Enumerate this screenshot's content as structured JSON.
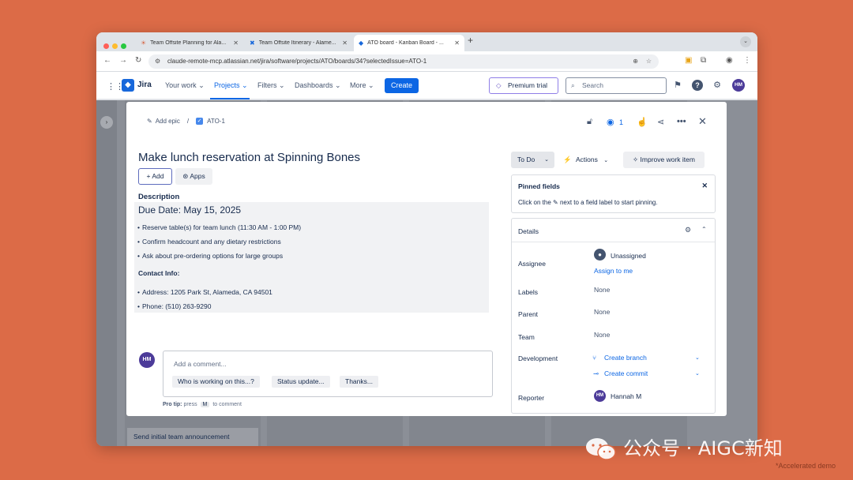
{
  "browser": {
    "tabs": [
      {
        "label": "Team Offsite Planning for Ala...",
        "icon": "☀"
      },
      {
        "label": "Team Offsite Itinerary - Alame...",
        "icon": "✖"
      },
      {
        "label": "ATO board - Kanban Board - ...",
        "icon": "◆"
      }
    ],
    "new_tab": "+",
    "url": "claude-remote-mcp.atlassian.net/jira/software/projects/ATO/boards/34?selectedIssue=ATO-1"
  },
  "jira_nav": {
    "logo": "Jira",
    "items": [
      "Your work ⌄",
      "Projects ⌄",
      "Filters ⌄",
      "Dashboards ⌄",
      "More ⌄"
    ],
    "create": "Create",
    "premium": "Premium trial",
    "search_placeholder": "Search",
    "user_initials": "HM"
  },
  "board": {
    "card_text": "Send initial team announcement"
  },
  "issue": {
    "breadcrumb_epic": "Add epic",
    "breadcrumb_sep": "/",
    "key": "ATO-1",
    "watch_count": "1",
    "title": "Make lunch reservation at Spinning Bones",
    "add_button": "+ Add",
    "apps_button": "Apps",
    "description_label": "Description",
    "due_date": "Due Date: May 15, 2025",
    "tasks": [
      "Reserve table(s) for team lunch (11:30 AM - 1:00 PM)",
      "Confirm headcount and any dietary restrictions",
      "Ask about pre-ordering options for large groups"
    ],
    "contact_heading": "Contact Info:",
    "contacts": [
      "Address: 1205 Park St, Alameda, CA 94501",
      "Phone: (510) 263-9290"
    ],
    "comment_avatar": "HM",
    "comment_placeholder": "Add a comment...",
    "quick_replies": [
      "Who is working on this...?",
      "Status update...",
      "Thanks..."
    ],
    "protip_label": "Pro tip:",
    "protip_pre": "press",
    "protip_key": "M",
    "protip_post": "to comment"
  },
  "side": {
    "status": "To Do",
    "actions": "Actions",
    "improve": "Improve work item",
    "pinned_title": "Pinned fields",
    "pinned_text": "Click on the ✎ next to a field label to start pinning.",
    "details_title": "Details",
    "fields": {
      "assignee_label": "Assignee",
      "assignee_value": "Unassigned",
      "assign_to_me": "Assign to me",
      "labels_label": "Labels",
      "labels_value": "None",
      "parent_label": "Parent",
      "parent_value": "None",
      "team_label": "Team",
      "team_value": "None",
      "development_label": "Development",
      "create_branch": "Create branch",
      "create_commit": "Create commit",
      "reporter_label": "Reporter",
      "reporter_initials": "HM",
      "reporter_value": "Hannah M"
    }
  },
  "watermark": {
    "text": "公众号 · AIGC新知",
    "footnote": "*Accelerated demo"
  }
}
